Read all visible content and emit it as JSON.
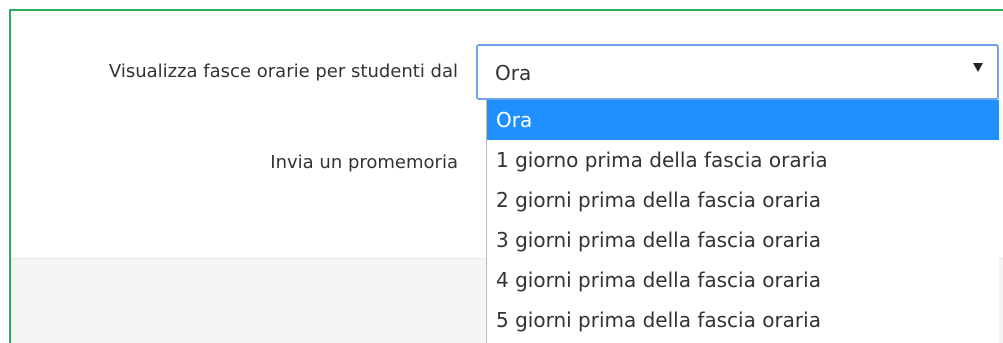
{
  "form": {
    "visualizza_label": "Visualizza fasce orarie per studenti dal",
    "invia_label": "Invia un promemoria"
  },
  "select": {
    "current_value": "Ora",
    "arrow_icon": "caret-down-icon"
  },
  "dropdown": {
    "options": [
      "Ora",
      "1 giorno prima della fascia oraria",
      "2 giorni prima della fascia oraria",
      "3 giorni prima della fascia oraria",
      "4 giorni prima della fascia oraria",
      "5 giorni prima della fascia oraria"
    ],
    "selected_index": 0
  },
  "colors": {
    "panel_border": "#2eac5e",
    "select_border": "#6ea4e6",
    "option_highlight": "#1e90ff"
  }
}
